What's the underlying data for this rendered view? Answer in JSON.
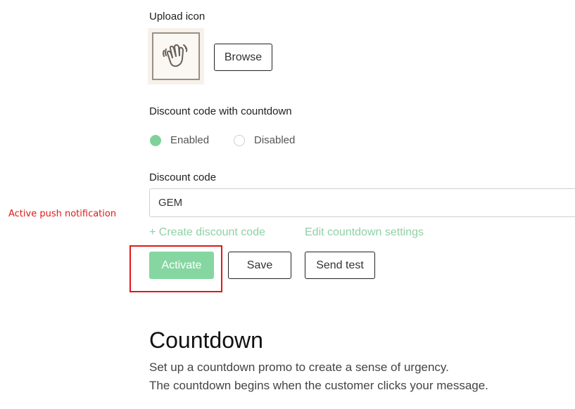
{
  "upload": {
    "label": "Upload icon",
    "icon": "waving-hand-icon",
    "browse_label": "Browse"
  },
  "discount_countdown": {
    "label": "Discount code with countdown",
    "options": [
      {
        "label": "Enabled",
        "selected": true
      },
      {
        "label": "Disabled",
        "selected": false
      }
    ]
  },
  "discount_code": {
    "label": "Discount code",
    "value": "GEM"
  },
  "links": {
    "create_discount": "+ Create discount code",
    "edit_countdown": "Edit countdown settings"
  },
  "actions": {
    "activate": "Activate",
    "save": "Save",
    "send_test": "Send test"
  },
  "annotation": {
    "text": "Active push notification",
    "color": "#e01818"
  },
  "countdown": {
    "title": "Countdown",
    "line1": "Set up a countdown promo to create a sense of urgency.",
    "line2": "The countdown begins when the customer clicks your message."
  },
  "colors": {
    "accent": "#86d6a1",
    "link": "#8fd1a5"
  }
}
